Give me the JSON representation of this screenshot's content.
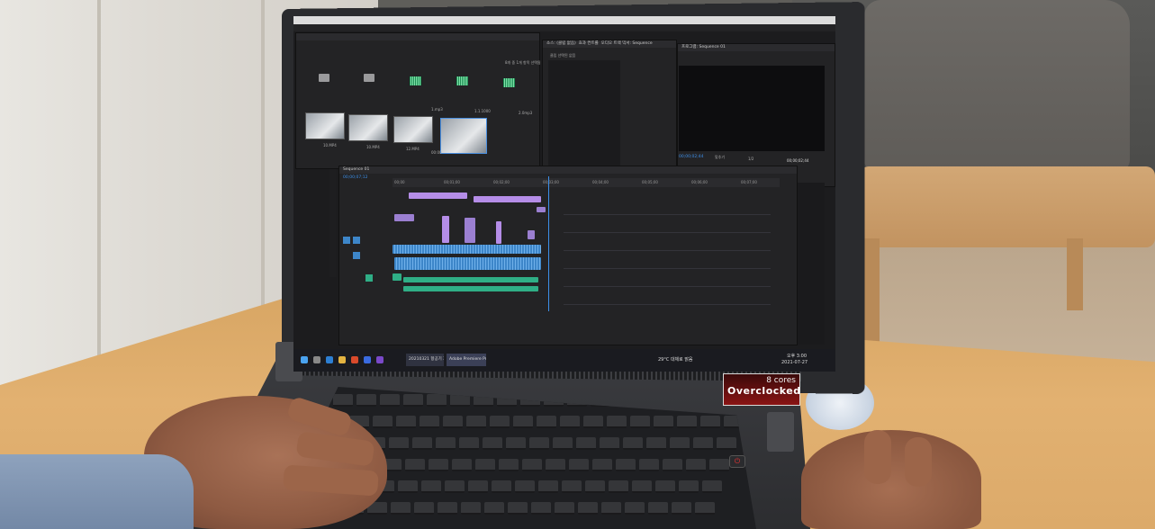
{
  "screen": {
    "panels": {
      "source": "소스: (클립 없음)",
      "effects": "효과 컨트롤",
      "audio_mixer": "오디오 트랙 믹서: Sequence",
      "program": "프로그램: Sequence 01",
      "no_clip": "클립 선택된 없음"
    },
    "program_timecode_left": "00;00;02;44",
    "program_timecode_right": "00;00;02;44",
    "program_fit": "맞추기",
    "program_ratio": "1/2",
    "timeline_tab": "Sequence 01",
    "timeline_timecode": "00;00;07;12",
    "project_status": "8개 중 1개 항목 선택됨",
    "project_items": [
      {
        "label": "10.MP4",
        "kind": "video"
      },
      {
        "label": "10.MP4",
        "kind": "video"
      },
      {
        "label": "12.MP4",
        "kind": "video"
      },
      {
        "label": "00:00",
        "kind": "video"
      }
    ],
    "audio_items": [
      {
        "label": "1.mp3"
      },
      {
        "label": "1.1.1000"
      },
      {
        "label": "2.0mp3"
      }
    ],
    "ruler_ticks": [
      "00;00",
      "00;01;00",
      "00;02;00",
      "00;03;00",
      "00;04;00",
      "00;05;00",
      "00;06;00",
      "00;07;00"
    ],
    "taskbar_apps": [
      "20210321 항공기 자",
      "Adobe Premiere Pr"
    ],
    "weather": "29°C 대체로 맑음",
    "clock": "오후 3:00",
    "date": "2021-07-27"
  },
  "laptop": {
    "sticker_cores": "8 cores",
    "sticker_oc": "Overclocked"
  },
  "colors": {
    "video_clip": "#9b7fd1",
    "audio_clip": "#3d86c9",
    "audio2_clip": "#2fae86",
    "playhead": "#3d8fe8"
  }
}
